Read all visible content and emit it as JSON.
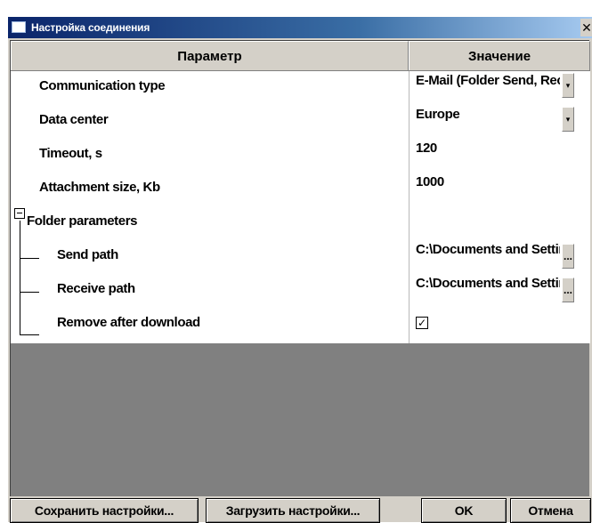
{
  "window": {
    "title": "Настройка соединения",
    "close_glyph": "✕"
  },
  "grid": {
    "columns": [
      "Параметр",
      "Значение"
    ],
    "rows": [
      {
        "label": "Communication type",
        "value": "E-Mail (Folder Send, Receive)",
        "control": "dropdown"
      },
      {
        "label": "Data center",
        "value": "Europe",
        "control": "dropdown"
      },
      {
        "label": "Timeout, s",
        "value": "120",
        "control": "text"
      },
      {
        "label": "Attachment size, Kb",
        "value": "1000",
        "control": "text"
      },
      {
        "label": "Folder parameters",
        "value": "",
        "control": "group",
        "expanded": true
      },
      {
        "label": "Send path",
        "value": "C:\\Documents and Settings",
        "control": "browse"
      },
      {
        "label": "Receive path",
        "value": "C:\\Documents and Settings",
        "control": "browse"
      },
      {
        "label": "Remove after download",
        "value": "",
        "control": "checkbox",
        "checked": true
      }
    ]
  },
  "buttons": {
    "save": "Сохранить настройки...",
    "load": "Загрузить настройки...",
    "ok": "OK",
    "cancel": "Отмена"
  },
  "icons": {
    "dropdown": "▾",
    "browse": "...",
    "check": "✓"
  },
  "colors": {
    "titlebar_start": "#0a246a",
    "titlebar_end": "#a6caf0",
    "face": "#d4d0c8",
    "empty_area": "#808080"
  }
}
